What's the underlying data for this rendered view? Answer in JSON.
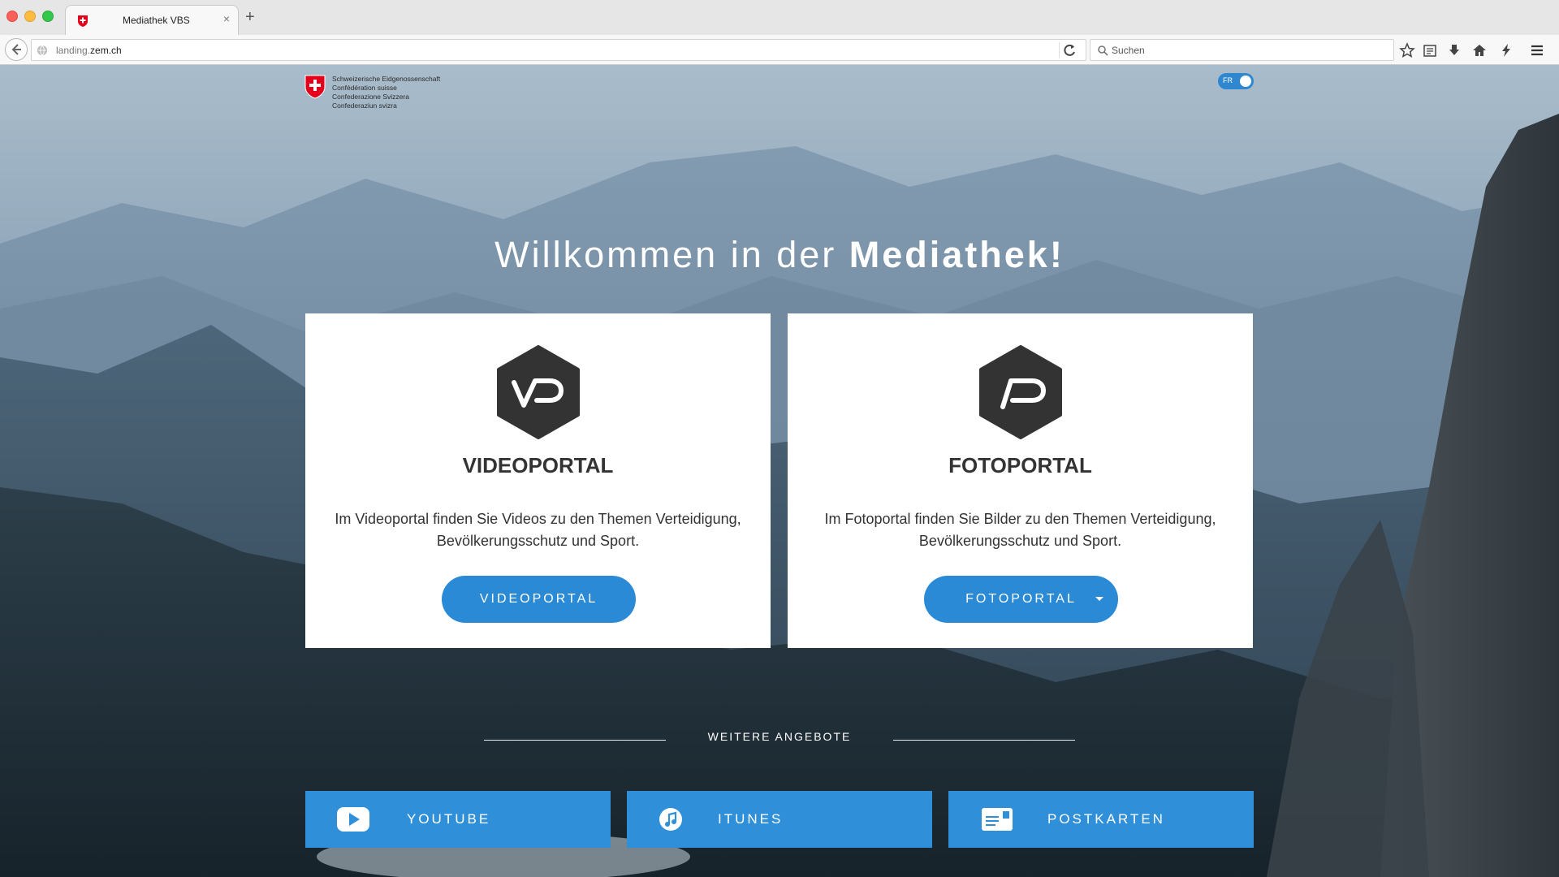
{
  "browser": {
    "tab_title": "Mediathek VBS",
    "url_host_prefix": "landing.",
    "url_host_domain": "zem.ch",
    "search_placeholder": "Suchen"
  },
  "header": {
    "logo_lines": [
      "Schweizerische Eidgenossenschaft",
      "Confédération suisse",
      "Confederazione Svizzera",
      "Confederaziun svizra"
    ],
    "language_toggle": "FR"
  },
  "headline": {
    "light": "Willkommen in der ",
    "bold": "Mediathek!"
  },
  "cards": [
    {
      "title": "VIDEOPORTAL",
      "description": "Im Videoportal finden Sie Videos zu den Themen Verteidigung, Bevölkerungsschutz und Sport.",
      "button": "VIDEOPORTAL",
      "icon": "videoportal-logo-icon"
    },
    {
      "title": "FOTOPORTAL",
      "description": "Im Fotoportal finden Sie Bilder zu den Themen Verteidigung, Bevölkerungsschutz und Sport.",
      "button": "FOTOPORTAL",
      "icon": "fotoportal-logo-icon"
    }
  ],
  "more": {
    "label": "WEITERE ANGEBOTE",
    "links": [
      {
        "label": "YOUTUBE",
        "icon": "youtube-icon"
      },
      {
        "label": "ITUNES",
        "icon": "itunes-icon"
      },
      {
        "label": "POSTKARTEN",
        "icon": "postcard-icon"
      }
    ]
  },
  "colors": {
    "accent": "#2b8ad6",
    "card_bg": "#ffffff",
    "text_dark": "#333333"
  }
}
